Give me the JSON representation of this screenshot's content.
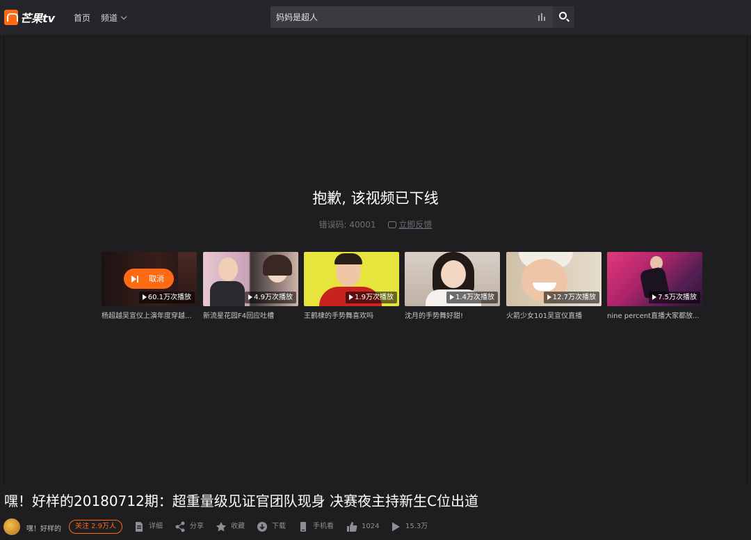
{
  "header": {
    "logo_text": "芒果tv",
    "nav_home": "首页",
    "nav_channel": "频道",
    "search_value": "妈妈是超人"
  },
  "player": {
    "message": "抱歉, 该视频已下线",
    "error_code": "错误码:  40001",
    "feedback": "立即反馈"
  },
  "recommendations": [
    {
      "title": "杨超越吴宣仪上演年度穿越...",
      "plays": "60.1万次播放",
      "overlay": "取消"
    },
    {
      "title": "新流星花园F4回应吐槽",
      "plays": "4.9万次播放"
    },
    {
      "title": "王鹤棣的手势舞喜欢吗",
      "plays": "1.9万次播放"
    },
    {
      "title": "沈月的手势舞好甜!",
      "plays": "1.4万次播放"
    },
    {
      "title": "火箭少女101吴宣仪直播",
      "plays": "12.7万次播放"
    },
    {
      "title": "nine percent直播大家都放...",
      "plays": "7.5万次播放"
    }
  ],
  "video": {
    "title": "嘿！好样的20180712期：超重量级见证官团队现身 决赛夜主持新生C位出道",
    "channel": "嘿！好样的",
    "follow": "关注 2.9万人"
  },
  "actions": {
    "detail": "详细",
    "share": "分享",
    "favorite": "收藏",
    "download": "下载",
    "mobile": "手机看",
    "likes": "1024",
    "plays": "15.3万"
  },
  "colors": {
    "accent": "#ff6a13",
    "background": "#1e1d20",
    "topbar": "#262529"
  }
}
